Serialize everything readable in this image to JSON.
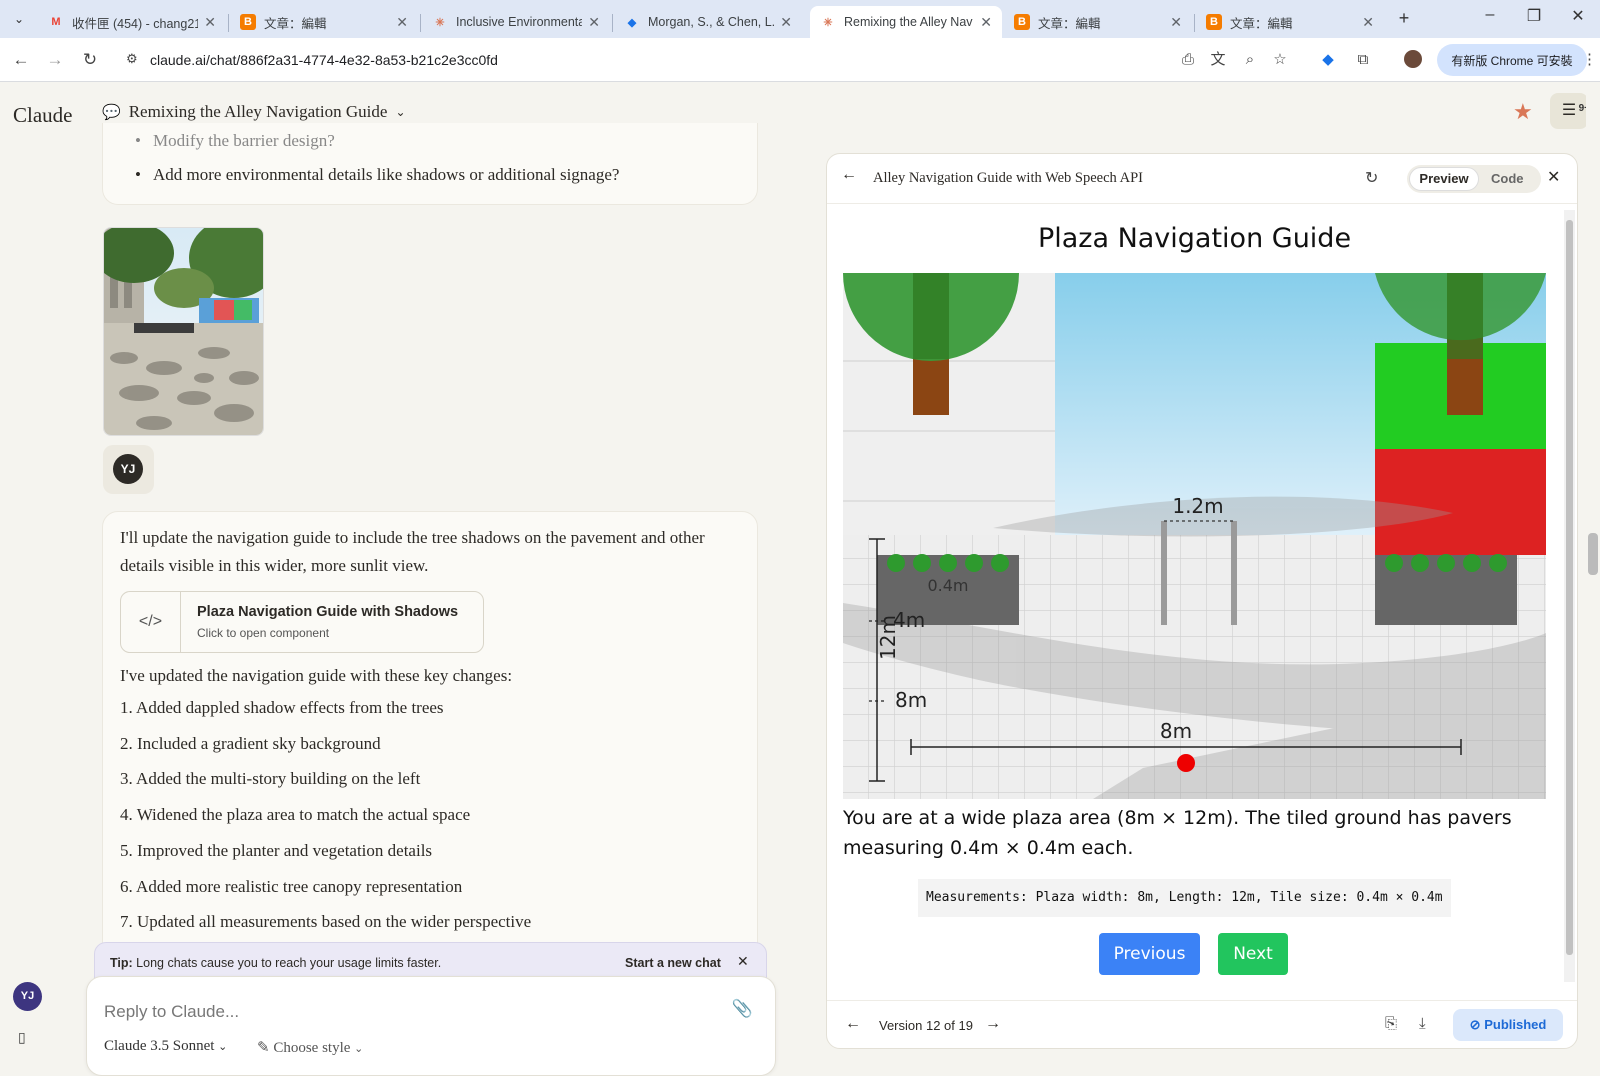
{
  "browser": {
    "tabs": [
      {
        "title": "收件匣 (454) - chang21",
        "icon": "gmail-icon",
        "active": false
      },
      {
        "title": "文章：編輯",
        "icon": "blogger-icon",
        "active": false
      },
      {
        "title": "Inclusive Environmenta",
        "icon": "claude-icon",
        "active": false
      },
      {
        "title": "Morgan, S., & Chen, L.",
        "icon": "drive-icon",
        "active": false
      },
      {
        "title": "Remixing the Alley Nav",
        "icon": "claude-icon",
        "active": true
      },
      {
        "title": "文章：編輯",
        "icon": "blogger-icon",
        "active": false
      },
      {
        "title": "文章：編輯",
        "icon": "blogger-icon",
        "active": false
      }
    ],
    "url": "claude.ai/chat/886f2a31-4774-4e32-8a53-b21c2e3cc0fd",
    "update_label": "有新版 Chrome 可安裝"
  },
  "app": {
    "logo": "Claude",
    "chat_title": "Remixing the Alley Navigation Guide",
    "settings_badge": "9+",
    "user_initials": "YJ"
  },
  "chat": {
    "prev_items": [
      "Modify the barrier design?",
      "Add more environmental details like shadows or additional signage?"
    ],
    "reply_intro": "I'll update the navigation guide to include the tree shadows on the pavement and other details visible in this wider, more sunlit view.",
    "artifact_card": {
      "title": "Plaza Navigation Guide with Shadows",
      "subtitle": "Click to open component"
    },
    "changes_intro": "I've updated the navigation guide with these key changes:",
    "changes": [
      "1. Added dappled shadow effects from the trees",
      "2. Included a gradient sky background",
      "3. Added the multi-story building on the left",
      "4. Widened the plaza area to match the actual space",
      "5. Improved the planter and vegetation details",
      "6. Added more realistic tree canopy representation",
      "7. Updated all measurements based on the wider perspective"
    ]
  },
  "tip": {
    "label": "Tip:",
    "text": "Long chats cause you to reach your usage limits faster.",
    "link": "Start a new chat"
  },
  "composer": {
    "placeholder": "Reply to Claude...",
    "model": "Claude 3.5 Sonnet",
    "style": "Choose style"
  },
  "artifact": {
    "header_title": "Alley Navigation Guide with Web Speech API",
    "preview_label": "Preview",
    "code_label": "Code",
    "guide_title": "Plaza Navigation Guide",
    "labels": {
      "gap": "1.2m",
      "planter": "0.4m",
      "length": "12m",
      "tick_4m": "4m",
      "tick_8m": "8m",
      "width": "8m"
    },
    "description": "You are at a wide plaza area (8m × 12m). The tiled ground has pavers measuring 0.4m × 0.4m each.",
    "measurements": "Measurements: Plaza width: 8m, Length: 12m, Tile size: 0.4m × 0.4m",
    "prev_button": "Previous",
    "next_button": "Next",
    "version": "Version 12 of 19",
    "published": "Published"
  },
  "colors": {
    "sky_top": "#87ceeb",
    "tree_canopy": "#3a9a3a",
    "trunk": "#8b4513",
    "signage_green": "#22cc22",
    "signage_red": "#dd2222",
    "planter": "#666666",
    "marker": "#ee0000",
    "prev_button": "#3b82f6",
    "next_button": "#22c55e"
  }
}
